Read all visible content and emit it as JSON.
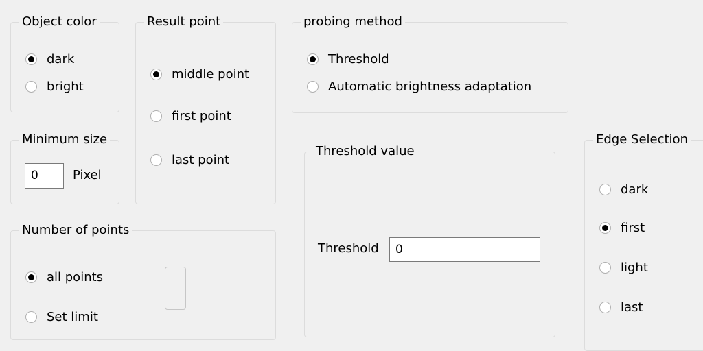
{
  "object_color": {
    "title": "Object color",
    "options": [
      {
        "label": "dark",
        "selected": true
      },
      {
        "label": "bright",
        "selected": false
      }
    ]
  },
  "result_point": {
    "title": "Result point",
    "options": [
      {
        "label": "middle point",
        "selected": true
      },
      {
        "label": "first point",
        "selected": false
      },
      {
        "label": "last point",
        "selected": false
      }
    ]
  },
  "probing_method": {
    "title": "probing method",
    "options": [
      {
        "label": "Threshold",
        "selected": true
      },
      {
        "label": "Automatic brightness adaptation",
        "selected": false
      }
    ]
  },
  "minimum_size": {
    "title": "Minimum size",
    "value": "0",
    "unit": "Pixel"
  },
  "threshold_value": {
    "title": "Threshold value",
    "label": "Threshold",
    "value": "0"
  },
  "edge_selection": {
    "title": "Edge Selection",
    "options": [
      {
        "label": "dark",
        "selected": false
      },
      {
        "label": "first",
        "selected": true
      },
      {
        "label": "light",
        "selected": false
      },
      {
        "label": "last",
        "selected": false
      }
    ]
  },
  "number_of_points": {
    "title": "Number of points",
    "options": [
      {
        "label": "all points",
        "selected": true
      },
      {
        "label": "Set limit",
        "selected": false
      }
    ]
  }
}
